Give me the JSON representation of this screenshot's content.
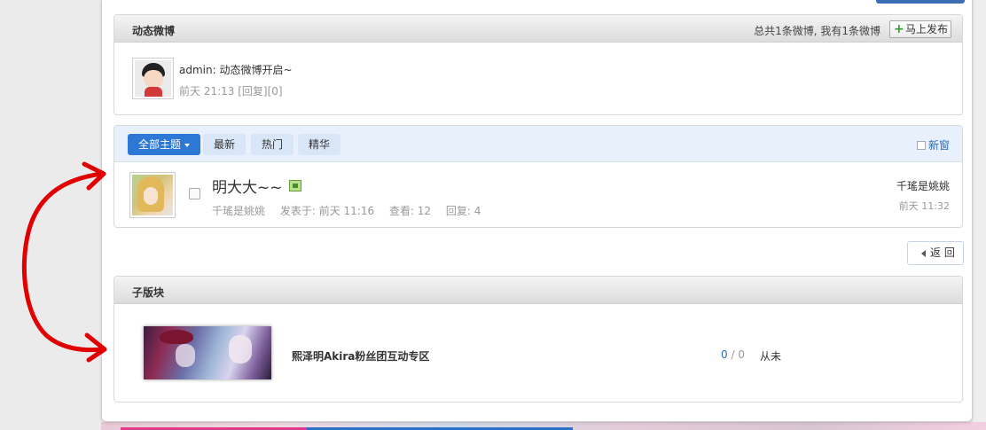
{
  "weibo": {
    "title": "动态微博",
    "stats": "总共1条微博, 我有1条微博",
    "publish_label": "马上发布",
    "message": "admin: 动态微博开启~",
    "meta": "前天 21:13 [回复][0]"
  },
  "threads": {
    "tabs": [
      {
        "label": "全部主题",
        "active": true
      },
      {
        "label": "最新"
      },
      {
        "label": "热门"
      },
      {
        "label": "精华"
      }
    ],
    "new_window_label": "新窗",
    "items": [
      {
        "title": "明大大~~",
        "author": "千瑤是姚姚",
        "posted": "发表于: 前天 11:16",
        "views": "查看: 12",
        "replies": "回复: 4",
        "last_user": "千瑤是姚姚",
        "last_time": "前天 11:32"
      }
    ]
  },
  "back_label": "返 回",
  "subforum": {
    "title": "子版块",
    "items": [
      {
        "name": "熙泽明Akira粉丝团互动专区",
        "count_a": "0",
        "sep": " / ",
        "count_b": "0",
        "last": "从未"
      }
    ]
  },
  "colors": {
    "accent": "#2c78d4",
    "tab_bg": "#d8e6f7",
    "arrow": "#e10000"
  },
  "icons": [
    "plus-icon",
    "caret-down-icon",
    "image-attachment-icon",
    "back-arrow-icon"
  ]
}
